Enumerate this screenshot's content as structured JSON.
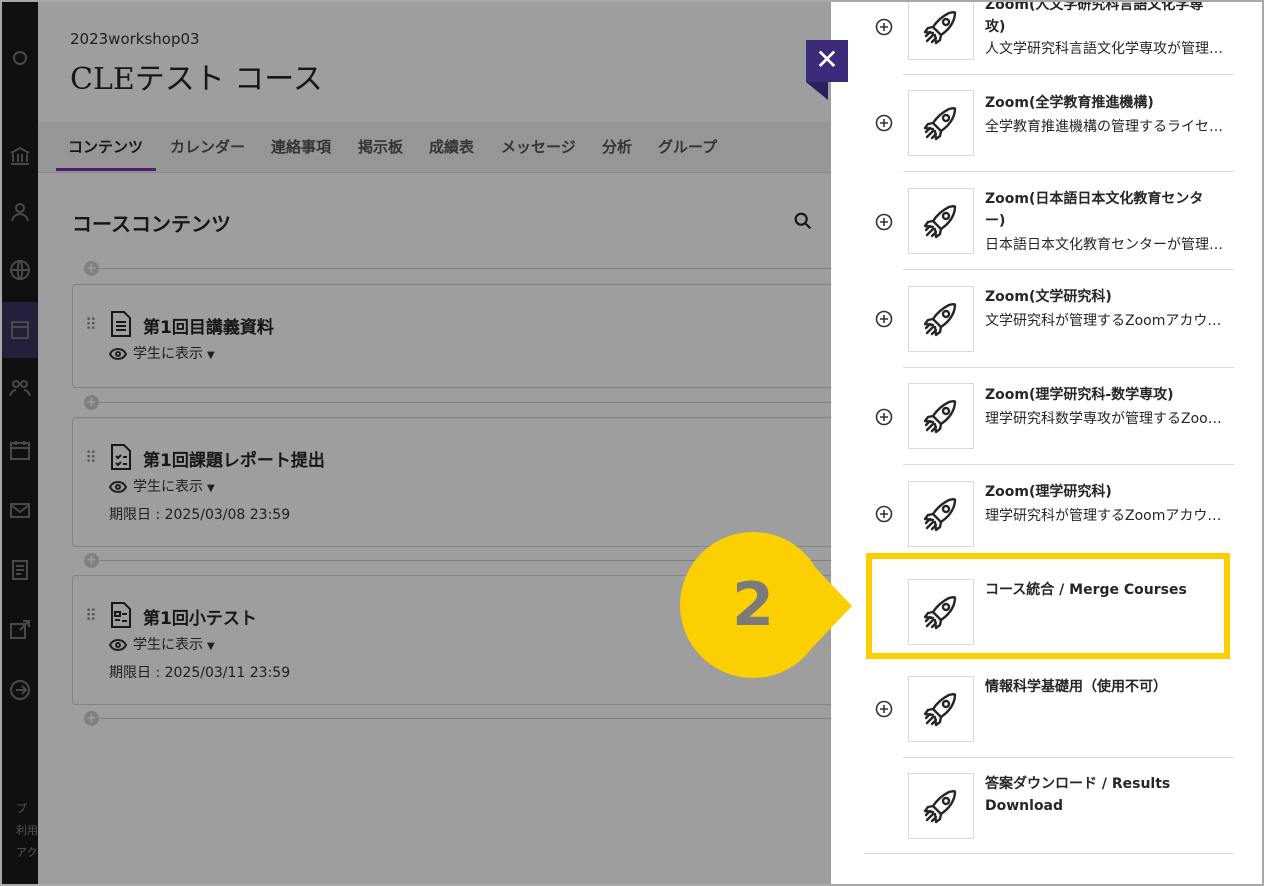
{
  "course": {
    "code": "2023workshop03",
    "title": "CLEテスト コース",
    "tabs": [
      "コンテンツ",
      "カレンダー",
      "連絡事項",
      "掲示板",
      "成績表",
      "メッセージ",
      "分析",
      "グループ"
    ],
    "active_tab": "コンテンツ",
    "section_title": "コースコンテンツ",
    "items": [
      {
        "title": "第1回目講義資料",
        "visibility": "学生に表示",
        "due": "",
        "icon": "document-icon"
      },
      {
        "title": "第1回課題レポート提出",
        "visibility": "学生に表示",
        "due": "期限日 : 2025/03/08 23:59",
        "icon": "assignment-icon"
      },
      {
        "title": "第1回小テスト",
        "visibility": "学生に表示",
        "due": "期限日 : 2025/03/11 23:59",
        "icon": "test-icon"
      }
    ]
  },
  "rail": {
    "footer": [
      "プ",
      "利用",
      "アク"
    ]
  },
  "panel": {
    "tools": [
      {
        "name": "Zoom(人文学研究科言語文化学専攻)",
        "desc": "人文学研究科言語文化学専攻が管理するZoomアカウント",
        "addable": true
      },
      {
        "name": "Zoom(全学教育推進機構)",
        "desc": "全学教育推進機構の管理するライセンス",
        "addable": true
      },
      {
        "name": "Zoom(日本語日本文化教育センター)",
        "desc": "日本語日本文化教育センターが管理するZoom",
        "addable": true
      },
      {
        "name": "Zoom(文学研究科)",
        "desc": "文学研究科が管理するZoomアカウント",
        "addable": true
      },
      {
        "name": "Zoom(理学研究科-数学専攻)",
        "desc": "理学研究科数学専攻が管理するZoomアカウント",
        "addable": true
      },
      {
        "name": "Zoom(理学研究科)",
        "desc": "理学研究科が管理するZoomアカウント",
        "addable": true
      },
      {
        "name": "コース統合 / Merge Courses",
        "desc": "",
        "addable": false
      },
      {
        "name": "情報科学基礎用（使用不可）",
        "desc": "",
        "addable": true
      },
      {
        "name": "答案ダウンロード / Results Download",
        "desc": "",
        "addable": false
      }
    ]
  },
  "callout": {
    "number": "2",
    "color": "#fbcf00"
  },
  "colors": {
    "accent": "#7d2fb6",
    "close": "#3c2a7a",
    "highlight": "#fbcf00"
  }
}
